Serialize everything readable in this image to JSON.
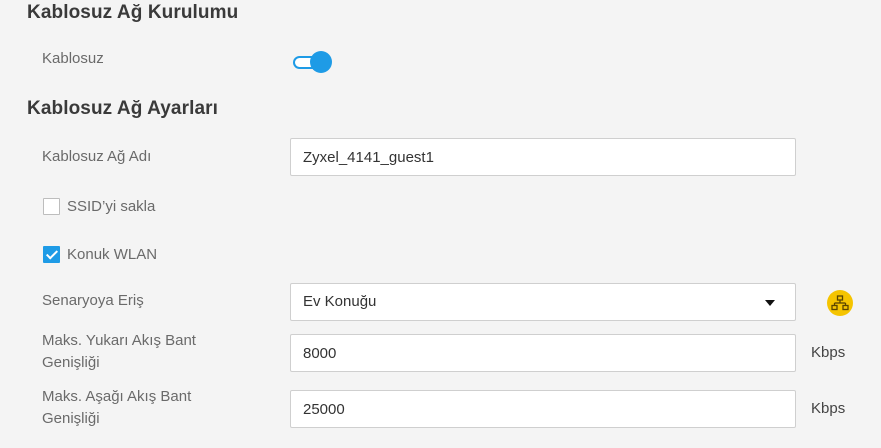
{
  "setup_section": {
    "title": "Kablosuz Ağ Kurulumu",
    "wireless_label": "Kablosuz",
    "wireless_enabled": true
  },
  "settings_section": {
    "title": "Kablosuz Ağ Ayarları",
    "network_name": {
      "label": "Kablosuz Ağ Adı",
      "value": "Zyxel_4141_guest1"
    },
    "hide_ssid": {
      "label": "SSID’yi sakla",
      "checked": false
    },
    "guest_wlan": {
      "label": "Konuk WLAN",
      "checked": true
    },
    "scenario_access": {
      "label": "Senaryoya Eriş",
      "selected": "Ev Konuğu",
      "icon": "network-topology-icon",
      "icon_color": "#f5c400"
    },
    "max_upstream": {
      "label_line1": "Maks. Yukarı Akış Bant",
      "label_line2": "Genişliği",
      "value": "8000",
      "unit": "Kbps"
    },
    "max_downstream": {
      "label_line1": "Maks. Aşağı Akış Bant",
      "label_line2": "Genişliği",
      "value": "25000",
      "unit": "Kbps"
    }
  },
  "colors": {
    "accent": "#1e9be6",
    "background": "#f4f4f4"
  }
}
